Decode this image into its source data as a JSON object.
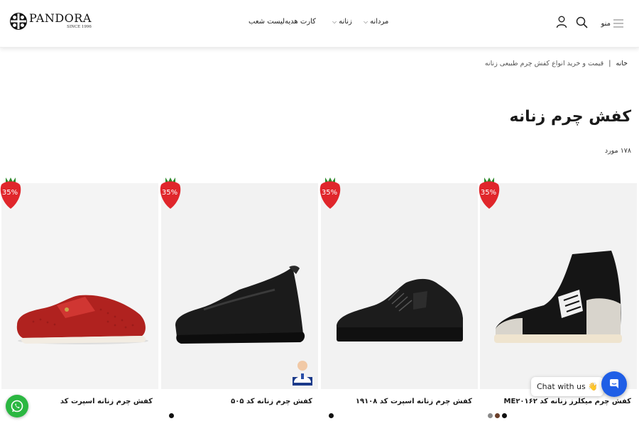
{
  "header": {
    "logo": {
      "name": "PANDORA",
      "since": "SINCE 1996"
    },
    "nav": [
      {
        "label": "مردانه",
        "has_dropdown": true
      },
      {
        "label": "زنانه",
        "has_dropdown": true
      },
      {
        "label": "کارت هدیه",
        "has_dropdown": false
      },
      {
        "label": "لیست شعب",
        "has_dropdown": false
      }
    ],
    "menu_label": "منو",
    "icons": [
      "hamburger-icon",
      "search-icon",
      "user-icon"
    ]
  },
  "breadcrumb": {
    "home": "خانه",
    "separator": "|",
    "current": "قیمت و خرید انواع کفش چرم طبیعی زنانه"
  },
  "page": {
    "title": "کفش چرم زنانه",
    "count": "۱۷۸ مورد"
  },
  "products": [
    {
      "name": "کفش چرم زنانه اسپرت کد",
      "discount": "35%",
      "swatches": []
    },
    {
      "name": "کفش چرم زنانه کد ۵۰۵",
      "discount": "35%",
      "swatches": [
        "#111111"
      ]
    },
    {
      "name": "کفش چرم زنانه اسپرت کد ۱۹۱۰۸",
      "discount": "35%",
      "swatches": [
        "#111111"
      ]
    },
    {
      "name": "کفش چرم میکلرز زنانه کد ME۲۰۱۶۲",
      "discount": "35%",
      "swatches": [
        "#8a8a8a",
        "#6b3f2a",
        "#111111"
      ]
    }
  ],
  "chat": {
    "label": "Chat with us 👋"
  },
  "colors": {
    "accent": "#1f5ee6",
    "whatsapp": "#2bb741",
    "badge": "#e0262b"
  }
}
